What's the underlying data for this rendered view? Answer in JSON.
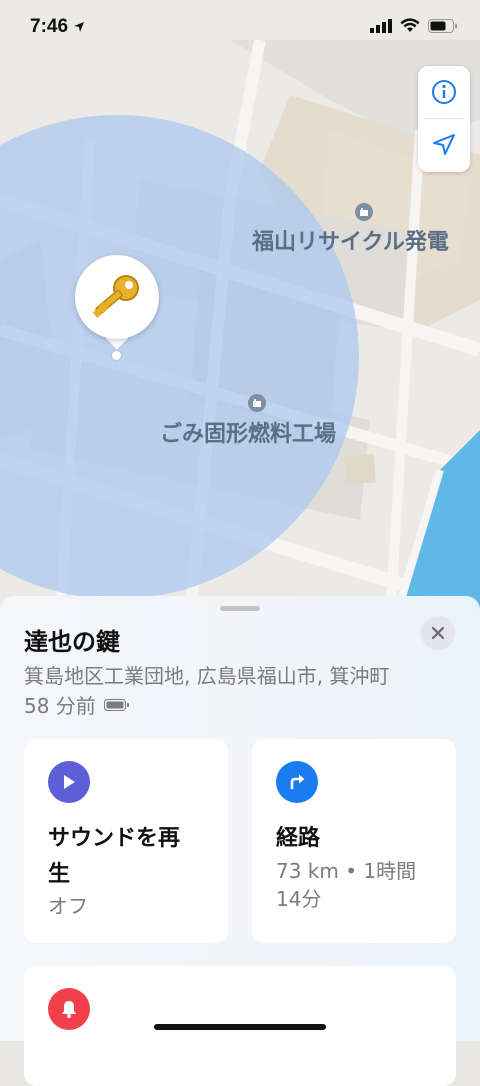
{
  "status": {
    "time": "7:46"
  },
  "map": {
    "poi_1": "福山リサイクル発電",
    "poi_2": "ごみ固形燃料工場",
    "info_icon": "info-icon",
    "location_icon": "location-arrow-icon",
    "accuracy_color": "#a9c7ef"
  },
  "sheet": {
    "title": "達也の鍵",
    "address": "箕島地区工業団地, 広島県福山市, 箕沖町",
    "time_ago": "58 分前",
    "cards": {
      "sound": {
        "title_line1": "サウンドを再",
        "title_line2": "生",
        "sub": "オフ",
        "color": "#5d5fd6"
      },
      "directions": {
        "title": "経路",
        "sub_line1": "73 km • 1時間",
        "sub_line2": "14分",
        "color": "#1a7cf0"
      },
      "notify": {
        "color": "#f0404a"
      }
    }
  }
}
